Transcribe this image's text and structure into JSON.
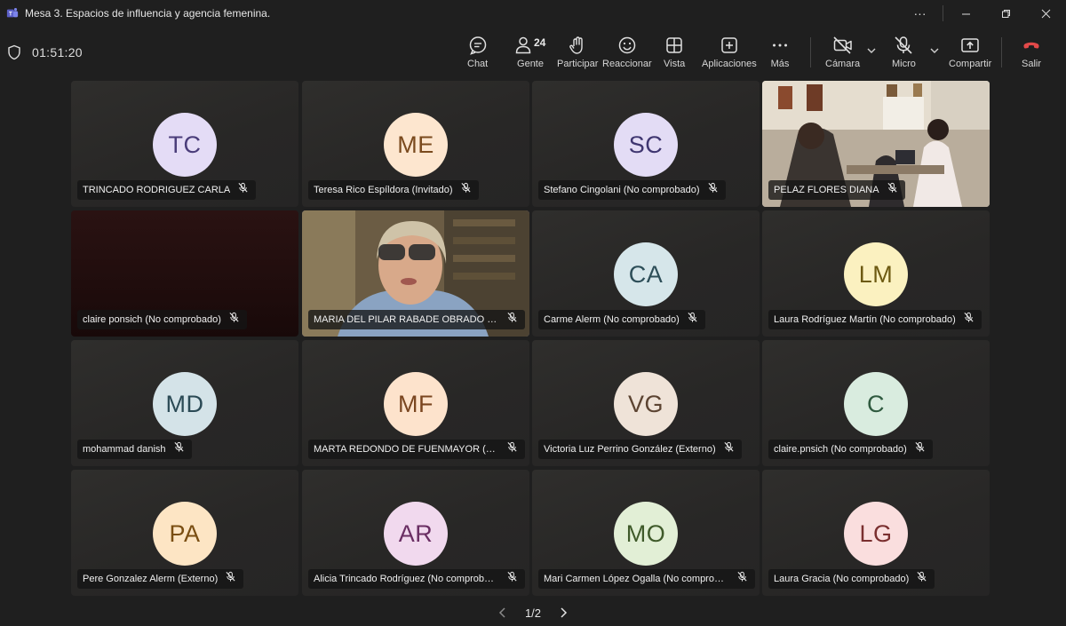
{
  "window": {
    "title": "Mesa 3. Espacios de influencia y agencia femenina."
  },
  "toolbar": {
    "timer": "01:51:20",
    "people_count": "24",
    "chat": "Chat",
    "people": "Gente",
    "raise": "Participar",
    "react": "Reaccionar",
    "view": "Vista",
    "apps": "Aplicaciones",
    "more": "Más",
    "camera": "Cámara",
    "mic": "Micro",
    "share": "Compartir",
    "leave": "Salir"
  },
  "colors": {
    "accent": "#7f85f5",
    "leave_red": "#e24949",
    "active_border": "#7f85f5"
  },
  "participants": [
    {
      "initials": "TC",
      "name": "TRINCADO RODRIGUEZ CARLA",
      "avatar_bg": "#e4dcf6",
      "avatar_fg": "#4a3d7a"
    },
    {
      "initials": "ME",
      "name": "Teresa Rico Espíldora (Invitado)",
      "avatar_bg": "#fde6cf",
      "avatar_fg": "#7a4a1e"
    },
    {
      "initials": "SC",
      "name": "Stefano Cingolani (No comprobado)",
      "avatar_bg": "#e3dcf5",
      "avatar_fg": "#3f3670"
    },
    {
      "initials": "",
      "name": "PELAZ FLORES DIANA",
      "video": "room"
    },
    {
      "initials": "",
      "name": "claire ponsich (No comprobado)",
      "video": "dark"
    },
    {
      "initials": "",
      "name": "MARIA DEL PILAR RABADE OBRADO (Externo)",
      "video": "person"
    },
    {
      "initials": "CA",
      "name": "Carme Alerm (No comprobado)",
      "avatar_bg": "#d6e6ea",
      "avatar_fg": "#2d4e58"
    },
    {
      "initials": "LM",
      "name": "Laura Rodríguez Martín (No comprobado)",
      "avatar_bg": "#fbf1c0",
      "avatar_fg": "#6d5a12"
    },
    {
      "initials": "MD",
      "name": "mohammad danish",
      "avatar_bg": "#d4e3e8",
      "avatar_fg": "#2b4a55"
    },
    {
      "initials": "MF",
      "name": "MARTA REDONDO DE FUENMAYOR (Externo)",
      "avatar_bg": "#fde3cc",
      "avatar_fg": "#7a4620"
    },
    {
      "initials": "VG",
      "name": "Victoria Luz Perrino González (Externo)",
      "avatar_bg": "#efe3d8",
      "avatar_fg": "#5c4432"
    },
    {
      "initials": "C",
      "name": "claire.pnsich (No comprobado)",
      "avatar_bg": "#d9ecdf",
      "avatar_fg": "#2f5a3f"
    },
    {
      "initials": "PA",
      "name": "Pere Gonzalez Alerm (Externo)",
      "avatar_bg": "#fde5c4",
      "avatar_fg": "#7a4e12"
    },
    {
      "initials": "AR",
      "name": "Alicia Trincado Rodríguez (No comprobado)",
      "avatar_bg": "#f1d9ee",
      "avatar_fg": "#6a2e63"
    },
    {
      "initials": "MO",
      "name": "Mari Carmen López Ogalla (No comprobado)",
      "avatar_bg": "#e2efd6",
      "avatar_fg": "#3f5a2a"
    },
    {
      "initials": "LG",
      "name": "Laura Gracia (No comprobado)",
      "avatar_bg": "#fadede",
      "avatar_fg": "#7a2f2f"
    }
  ],
  "pagination": {
    "label": "1/2"
  }
}
